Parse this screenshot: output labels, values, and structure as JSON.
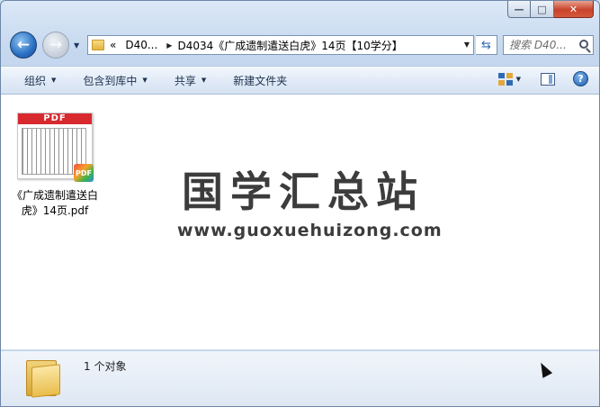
{
  "window": {
    "caption": {
      "minimize": "—",
      "maximize": "□",
      "close": "✕"
    }
  },
  "nav": {
    "back": "←",
    "forward": "→",
    "address": {
      "overflow": "«",
      "crumbs": [
        "D40...",
        "D4034《广成遗制遣送白虎》14页【10学分】"
      ]
    },
    "refresh": "⇆",
    "search_placeholder": "搜索 D40..."
  },
  "toolbar": {
    "items": [
      {
        "label": "组织",
        "has_menu": true
      },
      {
        "label": "包含到库中",
        "has_menu": true
      },
      {
        "label": "共享",
        "has_menu": true
      },
      {
        "label": "新建文件夹",
        "has_menu": false
      }
    ],
    "help": "?"
  },
  "content": {
    "files": [
      {
        "name": "《广成遗制遣送白虎》14页.pdf",
        "type": "pdf",
        "thumb_banner": "PDF",
        "badge": "PDF"
      }
    ],
    "watermark": {
      "title": "国学汇总站",
      "url": "www.guoxuehuizong.com"
    }
  },
  "status": {
    "text": "1 个对象"
  }
}
